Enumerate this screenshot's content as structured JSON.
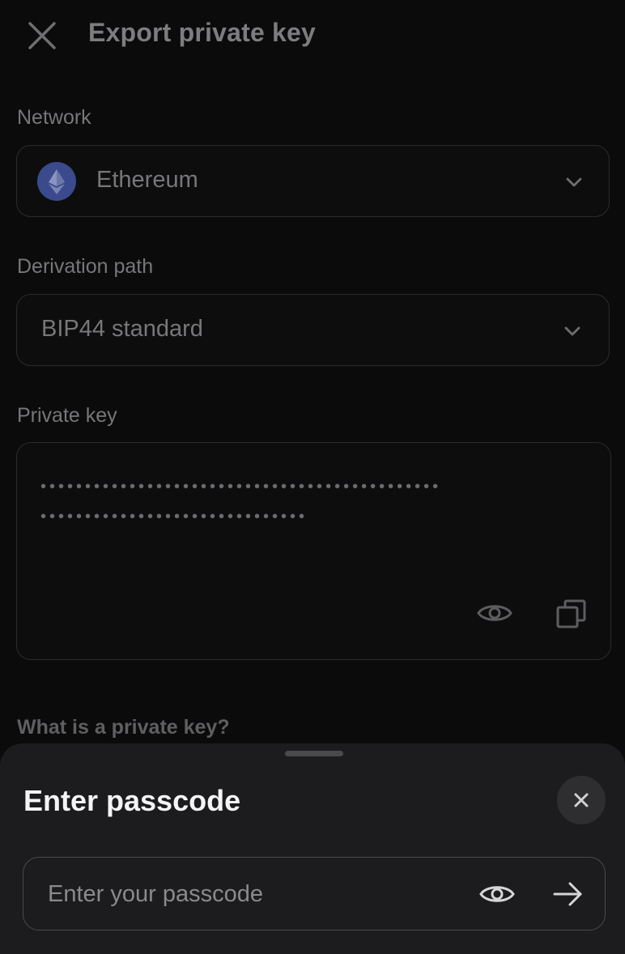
{
  "header": {
    "title": "Export private key",
    "close_icon": "close-icon"
  },
  "network": {
    "label": "Network",
    "value": "Ethereum",
    "icon": "ethereum-icon"
  },
  "derivation": {
    "label": "Derivation path",
    "value": "BIP44 standard"
  },
  "private_key": {
    "label": "Private key",
    "masked_line1": "•••••••••••••••••••••••••••••••••••••••••••••",
    "masked_line2": "••••••••••••••••••••••••••••••",
    "reveal_icon": "eye-icon",
    "copy_icon": "copy-icon"
  },
  "help_link": "What is a private key?",
  "sheet": {
    "title": "Enter passcode",
    "passcode_placeholder": "Enter your passcode",
    "passcode_value": "",
    "close_icon": "close-icon",
    "reveal_icon": "eye-icon",
    "submit_icon": "arrow-right-icon"
  },
  "colors": {
    "background": "#0b0b0c",
    "sheet": "#1c1c1e",
    "muted_text": "#77777a"
  }
}
